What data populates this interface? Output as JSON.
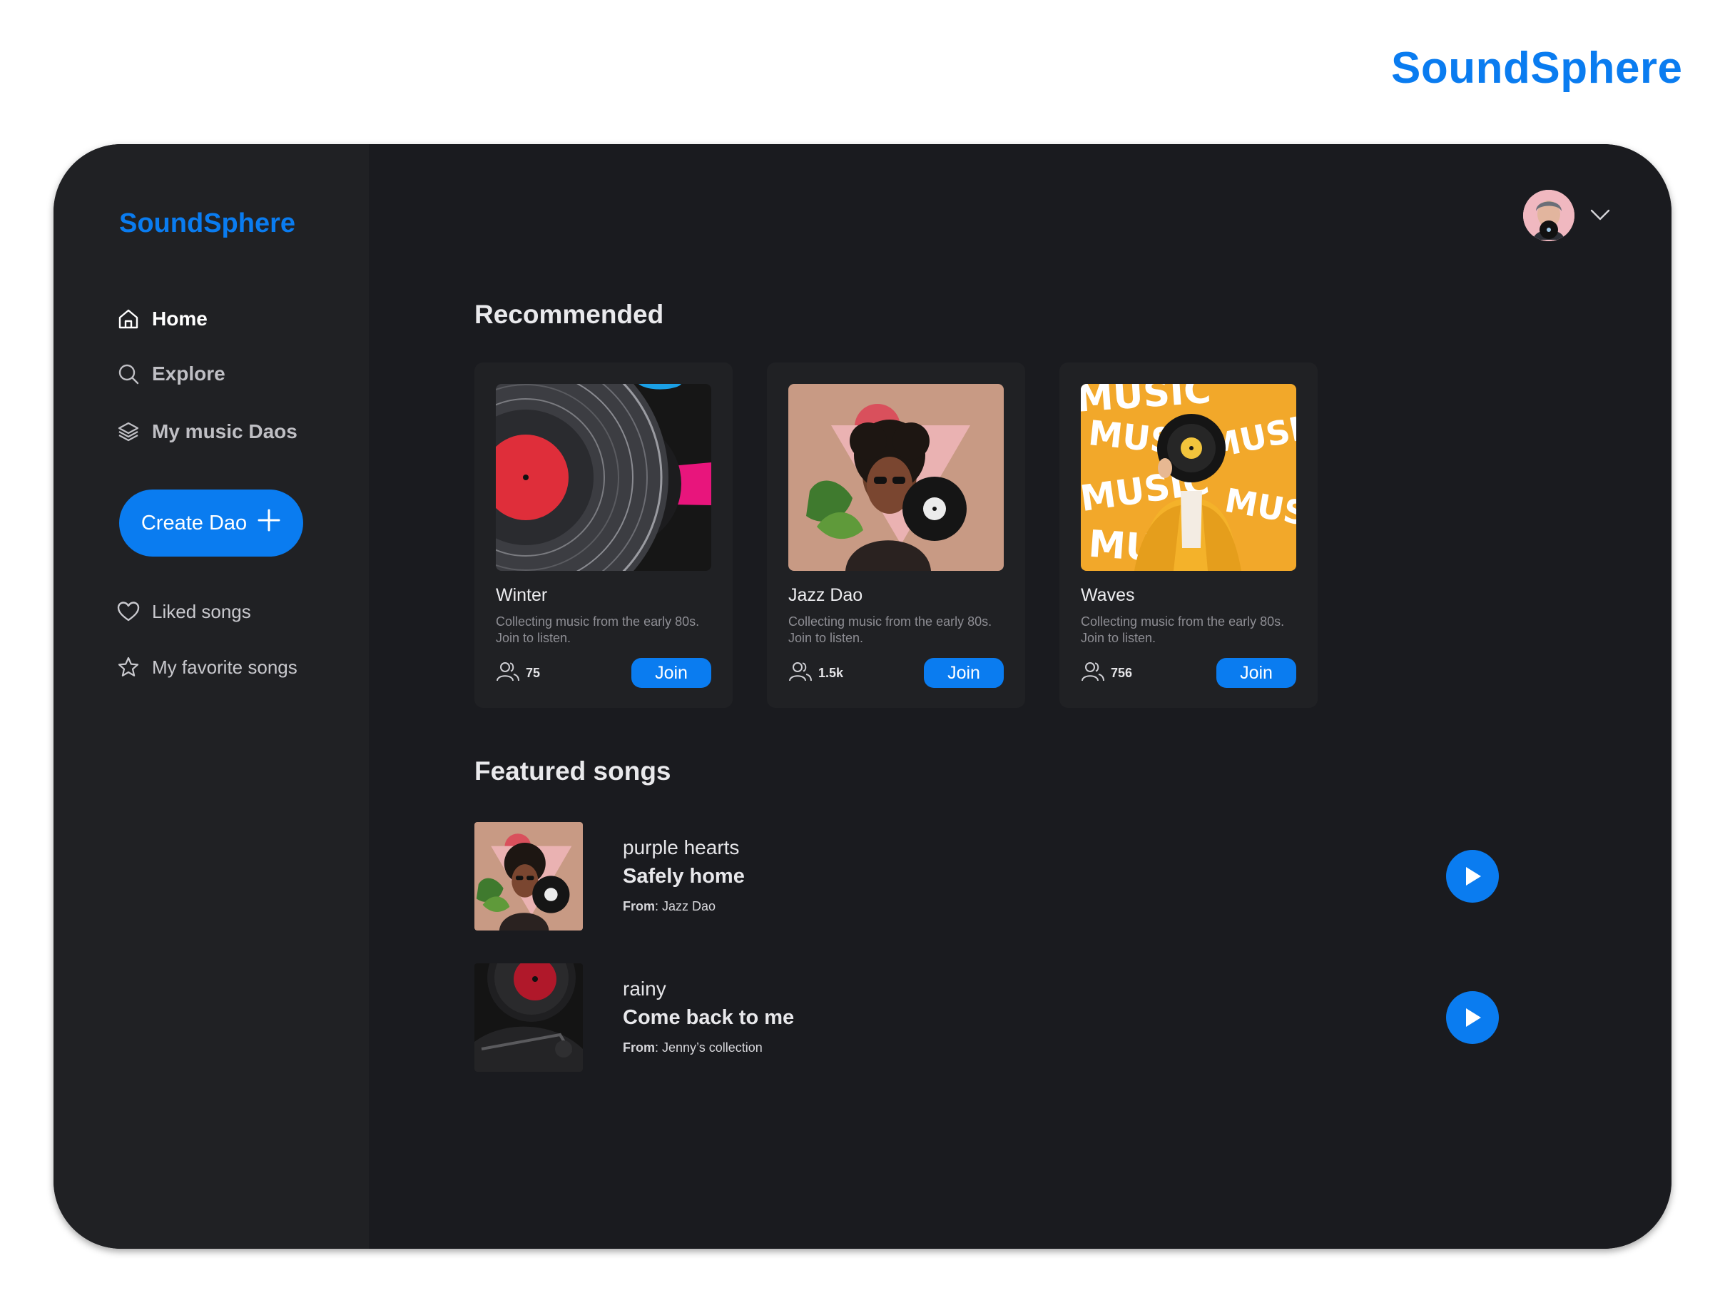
{
  "brand": {
    "name": "SoundSphere",
    "color": "#0a7cf0"
  },
  "sidebar": {
    "logo": "SoundSphere",
    "nav": [
      {
        "label": "Home",
        "icon": "home-icon",
        "active": true
      },
      {
        "label": "Explore",
        "icon": "search-icon"
      },
      {
        "label": "My music Daos",
        "icon": "layers-icon"
      }
    ],
    "create_button": "Create Dao",
    "library": [
      {
        "label": "Liked songs",
        "icon": "heart-icon"
      },
      {
        "label": "My favorite songs",
        "icon": "star-icon"
      }
    ]
  },
  "header": {
    "avatar": "user-avatar",
    "menu_icon": "chevron-down-icon"
  },
  "recommended": {
    "title": "Recommended",
    "cards": [
      {
        "title": "Winter",
        "description": "Collecting music from the early 80s. Join to  listen.",
        "members": "75",
        "join_label": "Join"
      },
      {
        "title": "Jazz Dao",
        "description": "Collecting music from the early 80s. Join to  listen.",
        "members": "1.5k",
        "join_label": "Join"
      },
      {
        "title": "Waves",
        "description": "Collecting music from the early 80s. Join to  listen.",
        "members": "756",
        "join_label": "Join"
      }
    ]
  },
  "featured": {
    "title": "Featured songs",
    "songs": [
      {
        "name": "purple hearts",
        "title": "Safely home",
        "from_label": "From",
        "from": ": Jazz Dao"
      },
      {
        "name": "rainy",
        "title": "Come back to me",
        "from_label": "From",
        "from": ": Jenny’s collection"
      }
    ]
  },
  "waves_cover_text": "MUSIC"
}
